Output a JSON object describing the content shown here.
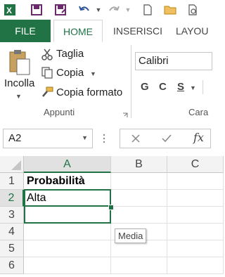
{
  "ribbon_tabs": [
    "FILE",
    "HOME",
    "INSERISCI",
    "LAYOU"
  ],
  "clipboard": {
    "paste_label": "Incolla",
    "cut_label": "Taglia",
    "copy_label": "Copia",
    "format_painter_label": "Copia formato",
    "group_label": "Appunti"
  },
  "font": {
    "font_name": "Calibri",
    "bold": "G",
    "italic": "C",
    "underline": "S",
    "group_label_partial": "Cara"
  },
  "formula_bar": {
    "name_box": "A2",
    "fx": "fx",
    "value": ""
  },
  "sheet": {
    "columns": [
      "A",
      "B",
      "C"
    ],
    "rows": [
      "1",
      "2",
      "3",
      "4",
      "5",
      "6"
    ],
    "cells": {
      "A1": "Probabilità",
      "A2": "Alta"
    },
    "active_cell": "A2"
  },
  "autocomplete_tooltip": "Media",
  "colors": {
    "excel_green": "#217346",
    "header_bg": "#f3f3f3"
  }
}
